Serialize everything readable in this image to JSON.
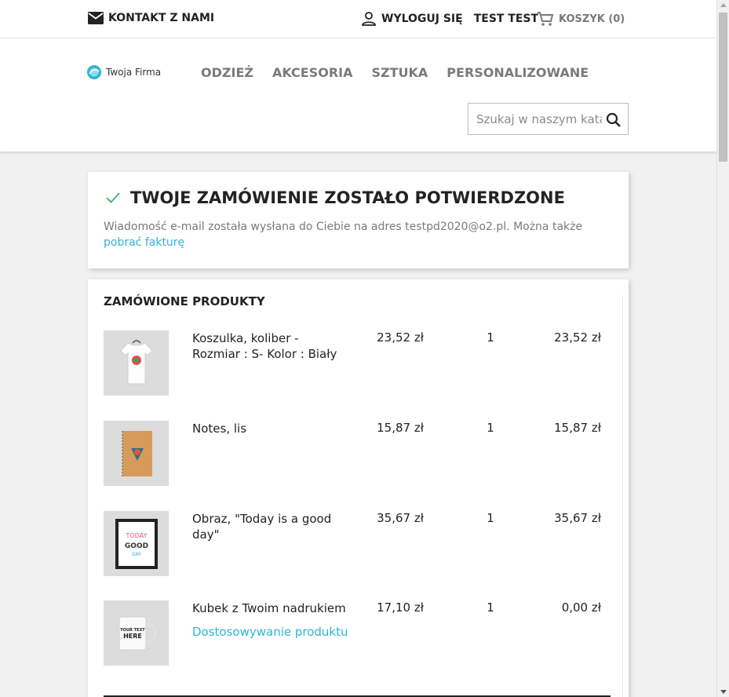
{
  "topbar": {
    "contact_label": "KONTAKT Z NAMI",
    "logout_label": "WYLOGUJ SIĘ",
    "user_name": "TEST TEST",
    "cart_label": "KOSZYK (0)"
  },
  "header": {
    "logo_text": "Twoja Firma",
    "menu": [
      "ODZIEŻ",
      "AKCESORIA",
      "SZTUKA",
      "PERSONALIZOWANE"
    ],
    "search_placeholder": "Szukaj w naszym katalogu"
  },
  "confirmation": {
    "title": "TWOJE ZAMÓWIENIE ZOSTAŁO POTWIERDZONE",
    "message": "Wiadomość e-mail została wysłana do Ciebie na adres testpd2020@o2.pl. Można także",
    "invoice_link": "pobrać fakturę"
  },
  "products": {
    "heading": "ZAMÓWIONE PRODUKTY",
    "items": [
      {
        "name": "Koszulka, koliber - Rozmiar : S- Kolor : Biały",
        "price": "23,52 zł",
        "qty": "1",
        "total": "23,52 zł",
        "icon": "tshirt-image"
      },
      {
        "name": "Notes, lis",
        "price": "15,87 zł",
        "qty": "1",
        "total": "15,87 zł",
        "icon": "notebook-image"
      },
      {
        "name": "Obraz, \"Today is a good day\"",
        "price": "35,67 zł",
        "qty": "1",
        "total": "35,67 zł",
        "icon": "poster-image"
      },
      {
        "name": "Kubek z Twoim nadrukiem",
        "price": "17,10 zł",
        "qty": "1",
        "total": "0,00 zł",
        "icon": "mug-image",
        "customization_link": "Dostosowywanie produktu"
      }
    ]
  },
  "colors": {
    "accent": "#2fb5d2",
    "check": "#4cbb6c",
    "text": "#232323",
    "muted": "#7a7a7a"
  }
}
